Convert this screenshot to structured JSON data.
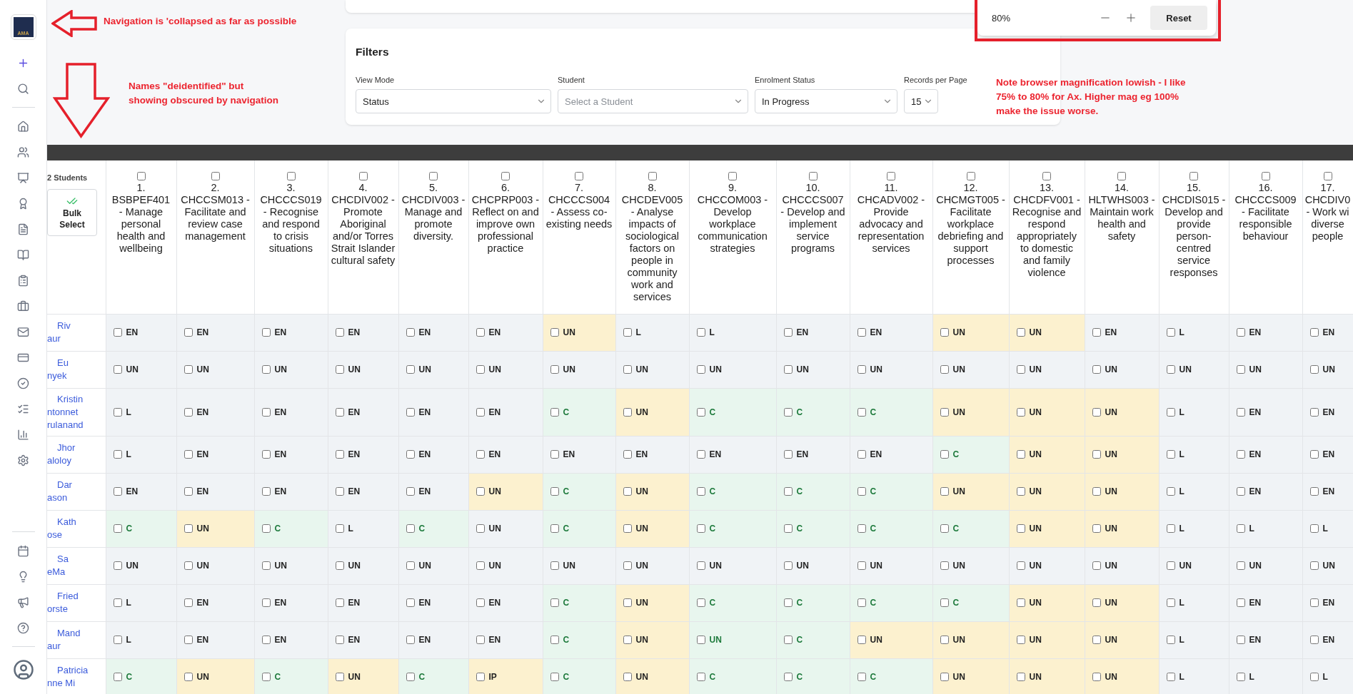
{
  "sidebar": {
    "logo_text": "AMA"
  },
  "annotations": [
    {
      "kind": "left-arrow",
      "lines": [
        "Navigation is 'collapsed as far as possible"
      ]
    },
    {
      "kind": "down-arrow",
      "lines": [
        "Names \"deidentified\" but",
        "showing obscured by navigation"
      ]
    },
    {
      "kind": "note",
      "lines": [
        "Note browser magnification lowish - I like",
        "75% to 80% for Ax. Higher mag eg 100%",
        "make the issue worse."
      ]
    }
  ],
  "zoom_popup": {
    "value": "80%",
    "reset": "Reset"
  },
  "filters": {
    "title": "Filters",
    "fields": [
      {
        "label": "View Mode",
        "value": "Status"
      },
      {
        "label": "Student",
        "placeholder": "Select a Student"
      },
      {
        "label": "Enrolment Status",
        "value": "In Progress"
      },
      {
        "label": "Records per Page",
        "value": "15"
      }
    ]
  },
  "table": {
    "student_count": "2 Students",
    "bulk_select": [
      "Bulk",
      "Select"
    ],
    "columns": [
      {
        "number": "1.",
        "title": "BSBPEF401 - Manage personal health and wellbeing",
        "checked": false
      },
      {
        "number": "2.",
        "title": "CHCCSM013 - Facilitate and review case management",
        "checked": false
      },
      {
        "number": "3.",
        "title": "CHCCCS019 - Recognise and respond to crisis situations",
        "checked": false
      },
      {
        "number": "4.",
        "title": "CHCDIV002 - Promote Aboriginal and/or Torres Strait Islander cultural safety",
        "checked": false
      },
      {
        "number": "5.",
        "title": "CHCDIV003 - Manage and promote diversity.",
        "checked": false
      },
      {
        "number": "6.",
        "title": "CHCPRP003 - Reflect on and improve own professional practice",
        "checked": false
      },
      {
        "number": "7.",
        "title": "CHCCCS004 - Assess co-existing needs",
        "checked": false
      },
      {
        "number": "8.",
        "title": "CHCDEV005 - Analyse impacts of sociological factors on people in community work and services",
        "checked": false
      },
      {
        "number": "9.",
        "title": "CHCCOM003 - Develop workplace communication strategies",
        "checked": false
      },
      {
        "number": "10.",
        "title": "CHCCCS007 - Develop and implement service programs",
        "checked": false
      },
      {
        "number": "11.",
        "title": "CHCADV002 - Provide advocacy and representation services",
        "checked": false
      },
      {
        "number": "12.",
        "title": "CHCMGT005 - Facilitate workplace debriefing and support processes",
        "checked": false
      },
      {
        "number": "13.",
        "title": "CHCDFV001 - Recognise and respond appropriately to domestic and family violence",
        "checked": false
      },
      {
        "number": "14.",
        "title": "HLTWHS003 - Maintain work health and safety",
        "checked": false
      },
      {
        "number": "15.",
        "title": "CHCDIS015 - Develop and provide person-centred service responses",
        "checked": false
      },
      {
        "number": "16.",
        "title": "CHCCCS009 - Facilitate responsible behaviour",
        "checked": false
      },
      {
        "number": "17.",
        "title": "CHCDIV0 - Work wi diverse people",
        "checked": false
      }
    ],
    "rows": [
      {
        "name_lines": [
          "Riv",
          "aur"
        ],
        "cells": [
          {
            "status": "EN",
            "color": "#f0f3f6",
            "checked": false
          },
          {
            "status": "EN",
            "color": "#f0f3f6",
            "checked": false
          },
          {
            "status": "EN",
            "color": "#f0f3f6",
            "checked": false
          },
          {
            "status": "EN",
            "color": "#f0f3f6",
            "checked": false
          },
          {
            "status": "EN",
            "color": "#f0f3f6",
            "checked": false
          },
          {
            "status": "EN",
            "color": "#f0f3f6",
            "checked": false
          },
          {
            "status": "UN",
            "color": "#fcf1cf",
            "checked": false
          },
          {
            "status": "L",
            "color": "#f0f3f6",
            "checked": false
          },
          {
            "status": "L",
            "color": "#f0f3f6",
            "checked": false
          },
          {
            "status": "EN",
            "color": "#f0f3f6",
            "checked": false
          },
          {
            "status": "EN",
            "color": "#f0f3f6",
            "checked": false
          },
          {
            "status": "UN",
            "color": "#fcf1cf",
            "checked": false
          },
          {
            "status": "UN",
            "color": "#fcf1cf",
            "checked": false
          },
          {
            "status": "EN",
            "color": "#f0f3f6",
            "checked": false
          },
          {
            "status": "L",
            "color": "#f0f3f6",
            "checked": false
          },
          {
            "status": "EN",
            "color": "#f0f3f6",
            "checked": false
          },
          {
            "status": "EN",
            "color": "#f0f3f6",
            "checked": false
          }
        ]
      },
      {
        "name_lines": [
          "Eu",
          "nyek"
        ],
        "cells": [
          {
            "status": "UN",
            "color": "#f0f3f6",
            "checked": false
          },
          {
            "status": "UN",
            "color": "#f0f3f6",
            "checked": false
          },
          {
            "status": "UN",
            "color": "#f0f3f6",
            "checked": false
          },
          {
            "status": "UN",
            "color": "#f0f3f6",
            "checked": false
          },
          {
            "status": "UN",
            "color": "#f0f3f6",
            "checked": false
          },
          {
            "status": "UN",
            "color": "#f0f3f6",
            "checked": false
          },
          {
            "status": "UN",
            "color": "#f0f3f6",
            "checked": false
          },
          {
            "status": "UN",
            "color": "#f0f3f6",
            "checked": false
          },
          {
            "status": "UN",
            "color": "#f0f3f6",
            "checked": false
          },
          {
            "status": "UN",
            "color": "#f0f3f6",
            "checked": false
          },
          {
            "status": "UN",
            "color": "#f0f3f6",
            "checked": false
          },
          {
            "status": "UN",
            "color": "#f0f3f6",
            "checked": false
          },
          {
            "status": "UN",
            "color": "#f0f3f6",
            "checked": false
          },
          {
            "status": "UN",
            "color": "#f0f3f6",
            "checked": false
          },
          {
            "status": "UN",
            "color": "#f0f3f6",
            "checked": false
          },
          {
            "status": "UN",
            "color": "#f0f3f6",
            "checked": false
          },
          {
            "status": "UN",
            "color": "#f0f3f6",
            "checked": false
          }
        ]
      },
      {
        "name_lines": [
          "Kristin",
          "ntonnet",
          "rulanand"
        ],
        "cells": [
          {
            "status": "L",
            "color": "#f0f3f6",
            "checked": false
          },
          {
            "status": "EN",
            "color": "#f0f3f6",
            "checked": false
          },
          {
            "status": "EN",
            "color": "#f0f3f6",
            "checked": false
          },
          {
            "status": "EN",
            "color": "#f0f3f6",
            "checked": false
          },
          {
            "status": "EN",
            "color": "#f0f3f6",
            "checked": false
          },
          {
            "status": "EN",
            "color": "#f0f3f6",
            "checked": false
          },
          {
            "status": "C",
            "color": "#e8f6ee",
            "checked": false
          },
          {
            "status": "UN",
            "color": "#fcf1cf",
            "checked": false
          },
          {
            "status": "C",
            "color": "#e8f6ee",
            "checked": false
          },
          {
            "status": "C",
            "color": "#e8f6ee",
            "checked": false
          },
          {
            "status": "C",
            "color": "#e8f6ee",
            "checked": false
          },
          {
            "status": "UN",
            "color": "#fcf1cf",
            "checked": false
          },
          {
            "status": "UN",
            "color": "#fcf1cf",
            "checked": false
          },
          {
            "status": "UN",
            "color": "#fcf1cf",
            "checked": false
          },
          {
            "status": "L",
            "color": "#f0f3f6",
            "checked": false
          },
          {
            "status": "EN",
            "color": "#f0f3f6",
            "checked": false
          },
          {
            "status": "EN",
            "color": "#f0f3f6",
            "checked": false
          }
        ]
      },
      {
        "name_lines": [
          "Jhor",
          "aloloy"
        ],
        "cells": [
          {
            "status": "L",
            "color": "#f0f3f6",
            "checked": false
          },
          {
            "status": "EN",
            "color": "#f0f3f6",
            "checked": false
          },
          {
            "status": "EN",
            "color": "#f0f3f6",
            "checked": false
          },
          {
            "status": "EN",
            "color": "#f0f3f6",
            "checked": false
          },
          {
            "status": "EN",
            "color": "#f0f3f6",
            "checked": false
          },
          {
            "status": "EN",
            "color": "#f0f3f6",
            "checked": false
          },
          {
            "status": "EN",
            "color": "#f0f3f6",
            "checked": false
          },
          {
            "status": "EN",
            "color": "#f0f3f6",
            "checked": false
          },
          {
            "status": "EN",
            "color": "#f0f3f6",
            "checked": false
          },
          {
            "status": "EN",
            "color": "#f0f3f6",
            "checked": false
          },
          {
            "status": "EN",
            "color": "#f0f3f6",
            "checked": false
          },
          {
            "status": "C",
            "color": "#e8f6ee",
            "checked": false
          },
          {
            "status": "UN",
            "color": "#fcf1cf",
            "checked": false
          },
          {
            "status": "UN",
            "color": "#fcf1cf",
            "checked": false
          },
          {
            "status": "L",
            "color": "#f0f3f6",
            "checked": false
          },
          {
            "status": "EN",
            "color": "#f0f3f6",
            "checked": false
          },
          {
            "status": "EN",
            "color": "#f0f3f6",
            "checked": false
          }
        ]
      },
      {
        "name_lines": [
          "Dar",
          "ason"
        ],
        "cells": [
          {
            "status": "EN",
            "color": "#f0f3f6",
            "checked": false
          },
          {
            "status": "EN",
            "color": "#f0f3f6",
            "checked": false
          },
          {
            "status": "EN",
            "color": "#f0f3f6",
            "checked": false
          },
          {
            "status": "EN",
            "color": "#f0f3f6",
            "checked": false
          },
          {
            "status": "EN",
            "color": "#f0f3f6",
            "checked": false
          },
          {
            "status": "UN",
            "color": "#fcf1cf",
            "checked": false
          },
          {
            "status": "C",
            "color": "#e8f6ee",
            "checked": false
          },
          {
            "status": "UN",
            "color": "#fcf1cf",
            "checked": false
          },
          {
            "status": "C",
            "color": "#e8f6ee",
            "checked": false
          },
          {
            "status": "C",
            "color": "#e8f6ee",
            "checked": false
          },
          {
            "status": "C",
            "color": "#e8f6ee",
            "checked": false
          },
          {
            "status": "UN",
            "color": "#fcf1cf",
            "checked": false
          },
          {
            "status": "UN",
            "color": "#fcf1cf",
            "checked": false
          },
          {
            "status": "UN",
            "color": "#fcf1cf",
            "checked": false
          },
          {
            "status": "L",
            "color": "#f0f3f6",
            "checked": false
          },
          {
            "status": "EN",
            "color": "#f0f3f6",
            "checked": false
          },
          {
            "status": "EN",
            "color": "#f0f3f6",
            "checked": false
          }
        ]
      },
      {
        "name_lines": [
          "Kath",
          "ose"
        ],
        "cells": [
          {
            "status": "C",
            "color": "#e8f6ee",
            "checked": false
          },
          {
            "status": "UN",
            "color": "#fcf1cf",
            "checked": false
          },
          {
            "status": "C",
            "color": "#e8f6ee",
            "checked": false
          },
          {
            "status": "L",
            "color": "#f0f3f6",
            "checked": false
          },
          {
            "status": "C",
            "color": "#e8f6ee",
            "checked": false
          },
          {
            "status": "UN",
            "color": "#f0f3f6",
            "checked": false
          },
          {
            "status": "C",
            "color": "#e8f6ee",
            "checked": false
          },
          {
            "status": "UN",
            "color": "#fcf1cf",
            "checked": false
          },
          {
            "status": "C",
            "color": "#e8f6ee",
            "checked": false
          },
          {
            "status": "C",
            "color": "#e8f6ee",
            "checked": false
          },
          {
            "status": "C",
            "color": "#e8f6ee",
            "checked": false
          },
          {
            "status": "C",
            "color": "#e8f6ee",
            "checked": false
          },
          {
            "status": "UN",
            "color": "#fcf1cf",
            "checked": false
          },
          {
            "status": "UN",
            "color": "#fcf1cf",
            "checked": false
          },
          {
            "status": "L",
            "color": "#f0f3f6",
            "checked": false
          },
          {
            "status": "L",
            "color": "#f0f3f6",
            "checked": false
          },
          {
            "status": "L",
            "color": "#f0f3f6",
            "checked": false
          }
        ]
      },
      {
        "name_lines": [
          "Sa",
          "eMa"
        ],
        "cells": [
          {
            "status": "UN",
            "color": "#f0f3f6",
            "checked": false
          },
          {
            "status": "UN",
            "color": "#f0f3f6",
            "checked": false
          },
          {
            "status": "UN",
            "color": "#f0f3f6",
            "checked": false
          },
          {
            "status": "UN",
            "color": "#f0f3f6",
            "checked": false
          },
          {
            "status": "UN",
            "color": "#f0f3f6",
            "checked": false
          },
          {
            "status": "UN",
            "color": "#f0f3f6",
            "checked": false
          },
          {
            "status": "UN",
            "color": "#f0f3f6",
            "checked": false
          },
          {
            "status": "UN",
            "color": "#f0f3f6",
            "checked": false
          },
          {
            "status": "UN",
            "color": "#f0f3f6",
            "checked": false
          },
          {
            "status": "UN",
            "color": "#f0f3f6",
            "checked": false
          },
          {
            "status": "UN",
            "color": "#f0f3f6",
            "checked": false
          },
          {
            "status": "UN",
            "color": "#f0f3f6",
            "checked": false
          },
          {
            "status": "UN",
            "color": "#f0f3f6",
            "checked": false
          },
          {
            "status": "UN",
            "color": "#f0f3f6",
            "checked": false
          },
          {
            "status": "UN",
            "color": "#f0f3f6",
            "checked": false
          },
          {
            "status": "UN",
            "color": "#f0f3f6",
            "checked": false
          },
          {
            "status": "UN",
            "color": "#f0f3f6",
            "checked": false
          }
        ]
      },
      {
        "name_lines": [
          "Fried",
          "orste"
        ],
        "cells": [
          {
            "status": "L",
            "color": "#f0f3f6",
            "checked": false
          },
          {
            "status": "EN",
            "color": "#f0f3f6",
            "checked": false
          },
          {
            "status": "EN",
            "color": "#f0f3f6",
            "checked": false
          },
          {
            "status": "EN",
            "color": "#f0f3f6",
            "checked": false
          },
          {
            "status": "EN",
            "color": "#f0f3f6",
            "checked": false
          },
          {
            "status": "EN",
            "color": "#f0f3f6",
            "checked": false
          },
          {
            "status": "C",
            "color": "#e8f6ee",
            "checked": false
          },
          {
            "status": "UN",
            "color": "#fcf1cf",
            "checked": false
          },
          {
            "status": "C",
            "color": "#e8f6ee",
            "checked": false
          },
          {
            "status": "C",
            "color": "#e8f6ee",
            "checked": false
          },
          {
            "status": "C",
            "color": "#e8f6ee",
            "checked": false
          },
          {
            "status": "C",
            "color": "#e8f6ee",
            "checked": false
          },
          {
            "status": "UN",
            "color": "#fcf1cf",
            "checked": false
          },
          {
            "status": "UN",
            "color": "#fcf1cf",
            "checked": false
          },
          {
            "status": "L",
            "color": "#f0f3f6",
            "checked": false
          },
          {
            "status": "EN",
            "color": "#f0f3f6",
            "checked": false
          },
          {
            "status": "EN",
            "color": "#f0f3f6",
            "checked": false
          }
        ]
      },
      {
        "name_lines": [
          "Mand",
          "aur"
        ],
        "cells": [
          {
            "status": "L",
            "color": "#f0f3f6",
            "checked": false
          },
          {
            "status": "EN",
            "color": "#f0f3f6",
            "checked": false
          },
          {
            "status": "EN",
            "color": "#f0f3f6",
            "checked": false
          },
          {
            "status": "EN",
            "color": "#f0f3f6",
            "checked": false
          },
          {
            "status": "EN",
            "color": "#f0f3f6",
            "checked": false
          },
          {
            "status": "EN",
            "color": "#f0f3f6",
            "checked": false
          },
          {
            "status": "C",
            "color": "#e8f6ee",
            "checked": false
          },
          {
            "status": "UN",
            "color": "#fcf1cf",
            "checked": false
          },
          {
            "status": "UN",
            "color": "#e8f6ee",
            "checked": false
          },
          {
            "status": "C",
            "color": "#e8f6ee",
            "checked": false
          },
          {
            "status": "UN",
            "color": "#fcf1cf",
            "checked": false
          },
          {
            "status": "UN",
            "color": "#fcf1cf",
            "checked": false
          },
          {
            "status": "UN",
            "color": "#fcf1cf",
            "checked": false
          },
          {
            "status": "UN",
            "color": "#fcf1cf",
            "checked": false
          },
          {
            "status": "L",
            "color": "#f0f3f6",
            "checked": false
          },
          {
            "status": "EN",
            "color": "#f0f3f6",
            "checked": false
          },
          {
            "status": "EN",
            "color": "#f0f3f6",
            "checked": false
          }
        ]
      },
      {
        "name_lines": [
          "Patricia",
          "nne Mi"
        ],
        "cells": [
          {
            "status": "C",
            "color": "#e8f6ee",
            "checked": false
          },
          {
            "status": "UN",
            "color": "#fcf1cf",
            "checked": false
          },
          {
            "status": "C",
            "color": "#e8f6ee",
            "checked": false
          },
          {
            "status": "UN",
            "color": "#fcf1cf",
            "checked": false
          },
          {
            "status": "C",
            "color": "#e8f6ee",
            "checked": false
          },
          {
            "status": "IP",
            "color": "#fcf1cf",
            "checked": false
          },
          {
            "status": "C",
            "color": "#e8f6ee",
            "checked": false
          },
          {
            "status": "UN",
            "color": "#fcf1cf",
            "checked": false
          },
          {
            "status": "C",
            "color": "#e8f6ee",
            "checked": false
          },
          {
            "status": "C",
            "color": "#e8f6ee",
            "checked": false
          },
          {
            "status": "C",
            "color": "#e8f6ee",
            "checked": false
          },
          {
            "status": "UN",
            "color": "#fcf1cf",
            "checked": false
          },
          {
            "status": "UN",
            "color": "#fcf1cf",
            "checked": false
          },
          {
            "status": "UN",
            "color": "#fcf1cf",
            "checked": false
          },
          {
            "status": "L",
            "color": "#f0f3f6",
            "checked": false
          },
          {
            "status": "L",
            "color": "#f0f3f6",
            "checked": false
          },
          {
            "status": "L",
            "color": "#f0f3f6",
            "checked": false
          }
        ]
      }
    ]
  }
}
